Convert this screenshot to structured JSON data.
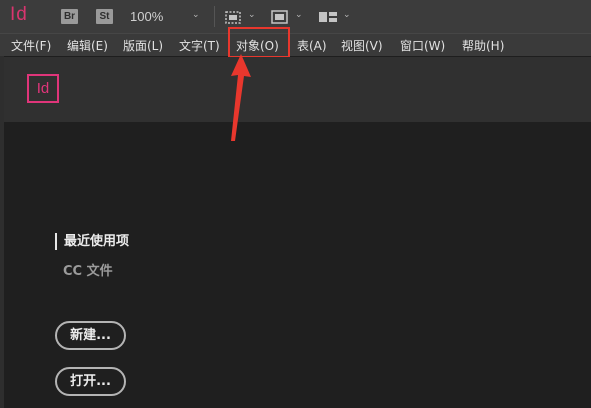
{
  "app": {
    "logo_text": "Id"
  },
  "toolbar": {
    "bridge_label": "Br",
    "stock_label": "St",
    "zoom": "100%",
    "icons": [
      "chevron-down-icon",
      "frame-grid-icon",
      "screen-mode-icon",
      "arrange-documents-icon"
    ]
  },
  "menu": {
    "items": [
      "文件(F)",
      "编辑(E)",
      "版面(L)",
      "文字(T)",
      "对象(O)",
      "表(A)",
      "视图(V)",
      "窗口(W)",
      "帮助(H)"
    ],
    "highlighted": "对象(O)"
  },
  "home": {
    "logo_text": "Id",
    "recent_label": "最近使用项",
    "cc_files_label": "CC 文件",
    "new_button": "新建...",
    "open_button": "打开..."
  },
  "colors": {
    "brand": "#d9356f",
    "annotation": "#e8372d",
    "menubar": "#3a3a3a",
    "background": "#1e1e1e"
  }
}
